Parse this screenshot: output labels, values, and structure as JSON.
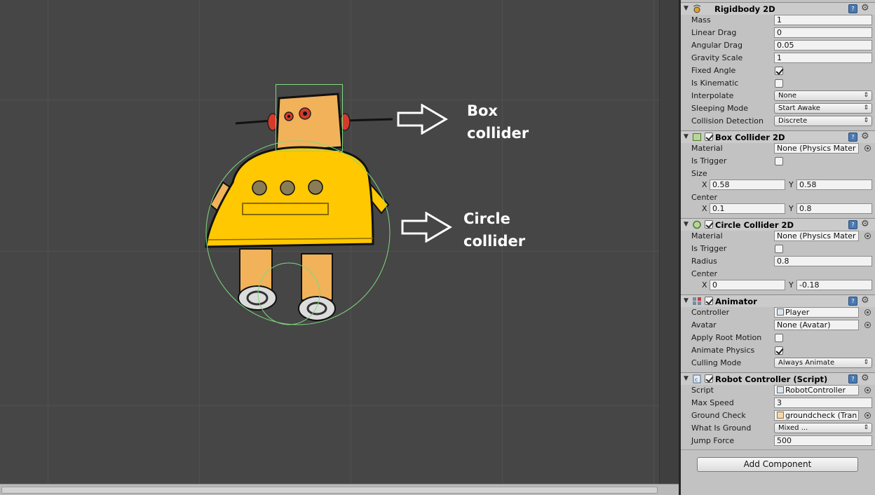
{
  "scene": {
    "annotation_box_line1": "Box",
    "annotation_box_line2": "collider",
    "annotation_circle_line1": "Circle",
    "annotation_circle_line2": "collider",
    "background_color": "#464646",
    "collider_outline_color": "#7fd97f",
    "robot_body_color": "#ffc800"
  },
  "inspector": {
    "rigidbody": {
      "title": "Rigidbody 2D",
      "icon": "rigidbody-icon",
      "fields": {
        "mass_label": "Mass",
        "mass_value": "1",
        "linear_drag_label": "Linear Drag",
        "linear_drag_value": "0",
        "angular_drag_label": "Angular Drag",
        "angular_drag_value": "0.05",
        "gravity_scale_label": "Gravity Scale",
        "gravity_scale_value": "1",
        "fixed_angle_label": "Fixed Angle",
        "fixed_angle_checked": true,
        "is_kinematic_label": "Is Kinematic",
        "is_kinematic_checked": false,
        "interpolate_label": "Interpolate",
        "interpolate_value": "None",
        "sleeping_mode_label": "Sleeping Mode",
        "sleeping_mode_value": "Start Awake",
        "collision_detection_label": "Collision Detection",
        "collision_detection_value": "Discrete"
      }
    },
    "box_collider": {
      "title": "Box Collider 2D",
      "icon": "box-collider-icon",
      "enabled": true,
      "fields": {
        "material_label": "Material",
        "material_value": "None (Physics Mater",
        "is_trigger_label": "Is Trigger",
        "is_trigger_checked": false,
        "size_label": "Size",
        "size_x_label": "X",
        "size_x_value": "0.58",
        "size_y_label": "Y",
        "size_y_value": "0.58",
        "center_label": "Center",
        "center_x_label": "X",
        "center_x_value": "0.1",
        "center_y_label": "Y",
        "center_y_value": "0.8"
      }
    },
    "circle_collider": {
      "title": "Circle Collider 2D",
      "icon": "circle-collider-icon",
      "enabled": true,
      "fields": {
        "material_label": "Material",
        "material_value": "None (Physics Mater",
        "is_trigger_label": "Is Trigger",
        "is_trigger_checked": false,
        "radius_label": "Radius",
        "radius_value": "0.8",
        "center_label": "Center",
        "center_x_label": "X",
        "center_x_value": "0",
        "center_y_label": "Y",
        "center_y_value": "-0.18"
      }
    },
    "animator": {
      "title": "Animator",
      "icon": "animator-icon",
      "enabled": true,
      "fields": {
        "controller_label": "Controller",
        "controller_value": "Player",
        "avatar_label": "Avatar",
        "avatar_value": "None (Avatar)",
        "apply_root_motion_label": "Apply Root Motion",
        "apply_root_motion_checked": false,
        "animate_physics_label": "Animate Physics",
        "animate_physics_checked": true,
        "culling_mode_label": "Culling Mode",
        "culling_mode_value": "Always Animate"
      }
    },
    "robot_controller": {
      "title": "Robot Controller (Script)",
      "icon": "script-icon",
      "enabled": true,
      "fields": {
        "script_label": "Script",
        "script_value": "RobotController",
        "max_speed_label": "Max Speed",
        "max_speed_value": "3",
        "ground_check_label": "Ground Check",
        "ground_check_value": "groundcheck (Tran",
        "what_is_ground_label": "What Is Ground",
        "what_is_ground_value": "Mixed ...",
        "jump_force_label": "Jump Force",
        "jump_force_value": "500"
      }
    },
    "add_component_label": "Add Component"
  }
}
